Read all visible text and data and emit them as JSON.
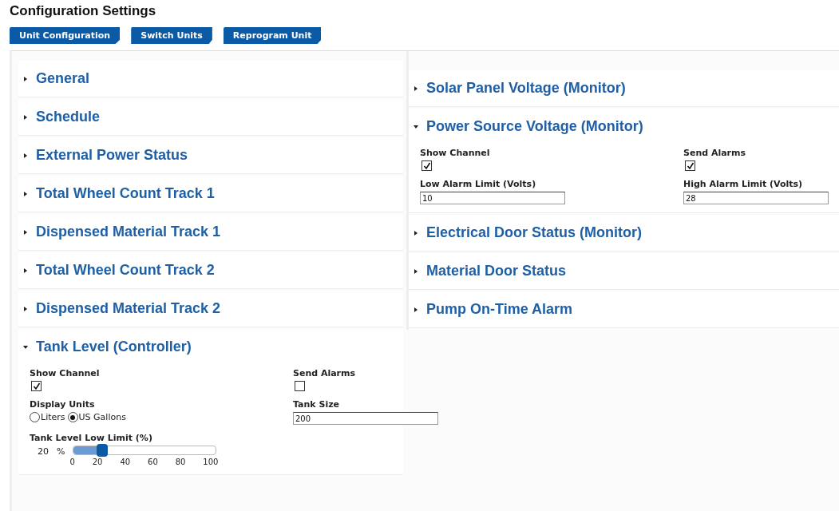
{
  "title": "Configuration Settings",
  "buttons": [
    "Unit Configuration",
    "Switch Units",
    "Reprogram Unit"
  ],
  "left_sections": [
    {
      "title": "General",
      "expanded": false
    },
    {
      "title": "Schedule",
      "expanded": false
    },
    {
      "title": "External Power Status",
      "expanded": false
    },
    {
      "title": "Total Wheel Count Track 1",
      "expanded": false
    },
    {
      "title": "Dispensed Material Track 1",
      "expanded": false
    },
    {
      "title": "Total Wheel Count Track 2",
      "expanded": false
    },
    {
      "title": "Dispensed Material Track 2",
      "expanded": false
    },
    {
      "title": "Tank Level (Controller)",
      "expanded": true,
      "fields": [
        {
          "kind": "checkbox",
          "label": "Show Channel",
          "checked": true
        },
        {
          "kind": "checkbox",
          "label": "Send Alarms",
          "checked": false
        },
        {
          "kind": "radio",
          "label": "Display Units",
          "options": [
            {
              "label": "Liters",
              "selected": false
            },
            {
              "label": "US Gallons",
              "selected": true
            }
          ]
        },
        {
          "kind": "text",
          "label": "Tank Size",
          "value": "200"
        },
        {
          "kind": "slider",
          "label": "Tank Level Low Limit (%)",
          "reading": "20",
          "unit": "%",
          "level": 0.2,
          "ticks": [
            "0",
            "20",
            "40",
            "60",
            "80",
            "100"
          ]
        }
      ]
    }
  ],
  "right_sections": [
    {
      "title": "Solar Panel Voltage (Monitor)",
      "expanded": false
    },
    {
      "title": "Power Source Voltage (Monitor)",
      "expanded": true,
      "fields": [
        {
          "kind": "checkbox",
          "label": "Show Channel",
          "checked": true
        },
        {
          "kind": "checkbox",
          "label": "Send Alarms",
          "checked": true
        },
        {
          "kind": "text",
          "label": "Low Alarm Limit (Volts)",
          "value": "10"
        },
        {
          "kind": "text",
          "label": "High Alarm Limit (Volts)",
          "value": "28"
        }
      ]
    },
    {
      "title": "Electrical Door Status (Monitor)",
      "expanded": false
    },
    {
      "title": "Material Door Status",
      "expanded": false
    },
    {
      "title": "Pump On-Time Alarm",
      "expanded": false
    }
  ]
}
